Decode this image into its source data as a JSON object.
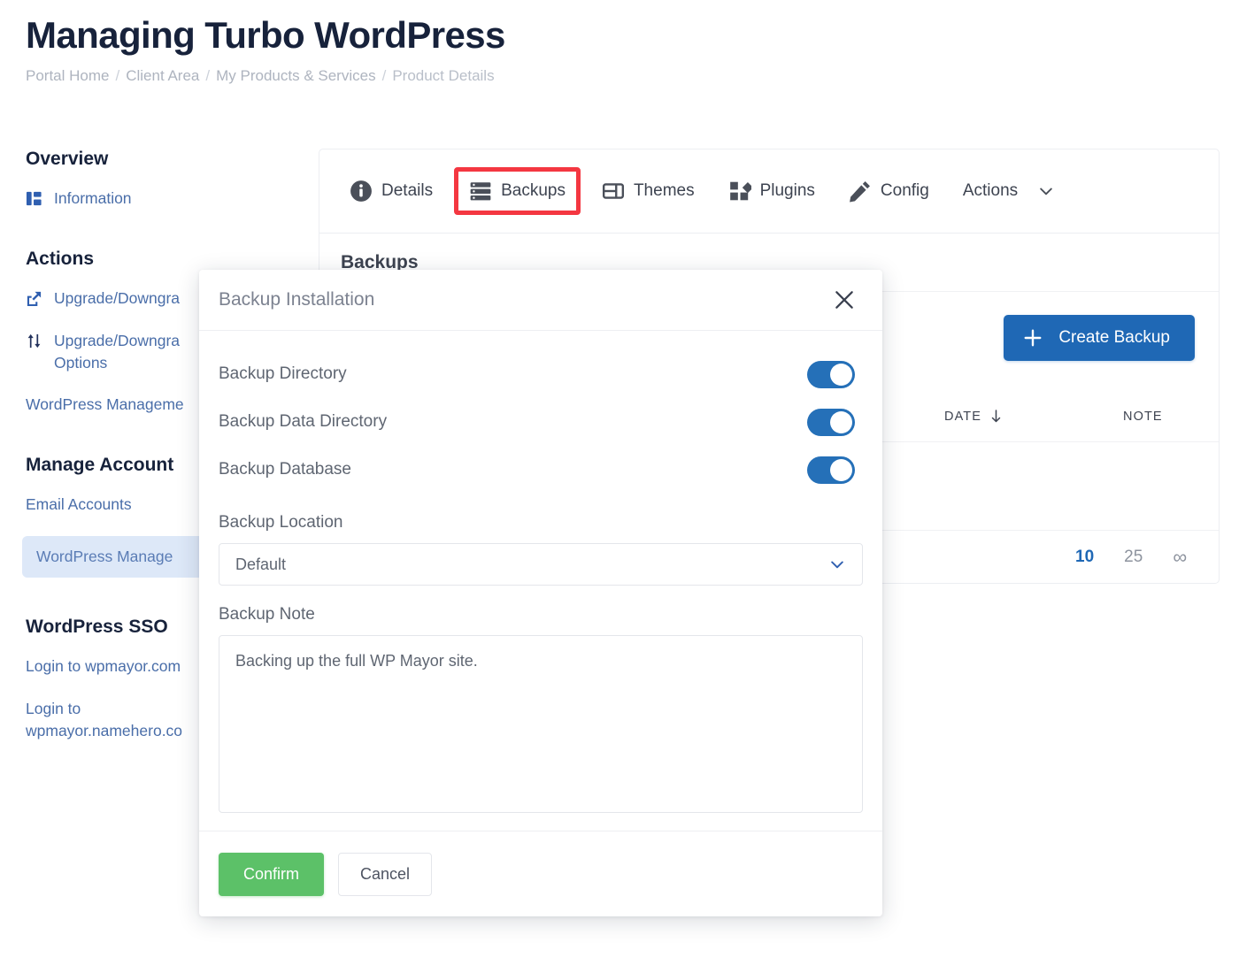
{
  "header": {
    "title": "Managing Turbo WordPress",
    "breadcrumb": [
      "Portal Home",
      "Client Area",
      "My Products & Services",
      "Product Details"
    ],
    "separator": "/"
  },
  "sidebar": {
    "groups": [
      {
        "title": "Overview",
        "items": [
          {
            "label": "Information",
            "icon": "layout-columns-icon",
            "active": false
          }
        ]
      },
      {
        "title": "Actions",
        "items": [
          {
            "label": "Upgrade/Downgra",
            "icon": "external-link-icon",
            "active": false
          },
          {
            "label": "Upgrade/Downgra Options",
            "icon": "arrows-up-down-icon",
            "active": false
          },
          {
            "label": "WordPress Manageme",
            "icon": "none",
            "active": false
          }
        ]
      },
      {
        "title": "Manage Account",
        "items": [
          {
            "label": "Email Accounts",
            "icon": "none",
            "active": false
          },
          {
            "label": "WordPress Manage",
            "icon": "none",
            "active": true
          }
        ]
      },
      {
        "title": "WordPress SSO",
        "items": [
          {
            "label": "Login to wpmayor.com",
            "icon": "none",
            "active": false
          },
          {
            "label": "Login to wpmayor.namehero.co",
            "icon": "none",
            "active": false
          }
        ]
      }
    ]
  },
  "tabs": [
    {
      "label": "Details",
      "icon": "info-circle-icon",
      "highlighted": false
    },
    {
      "label": "Backups",
      "icon": "server-stack-icon",
      "highlighted": true
    },
    {
      "label": "Themes",
      "icon": "layout-panel-icon",
      "highlighted": false
    },
    {
      "label": "Plugins",
      "icon": "plugin-blocks-icon",
      "highlighted": false
    },
    {
      "label": "Config",
      "icon": "pencil-icon",
      "highlighted": false
    },
    {
      "label": "Actions",
      "icon": "chevron-down-icon",
      "highlighted": false
    }
  ],
  "panel": {
    "heading": "Backups",
    "create_button": {
      "label": "Create Backup",
      "icon": "plus-icon"
    },
    "columns": [
      {
        "label": "DATE",
        "sort_icon": "sort-arrow-down-icon"
      },
      {
        "label": "NOTE",
        "sort_icon": "none"
      }
    ],
    "rows": [],
    "pagination": [
      {
        "label": "10",
        "active": true
      },
      {
        "label": "25",
        "active": false
      },
      {
        "label": "∞",
        "active": false
      }
    ]
  },
  "modal": {
    "title": "Backup Installation",
    "close_icon": "close-icon",
    "toggles": [
      {
        "label": "Backup Directory",
        "on": true
      },
      {
        "label": "Backup Data Directory",
        "on": true
      },
      {
        "label": "Backup Database",
        "on": true
      }
    ],
    "location": {
      "label": "Backup Location",
      "value": "Default",
      "chevron_icon": "chevron-down-icon"
    },
    "note": {
      "label": "Backup Note",
      "value": "Backing up the full WP Mayor site.",
      "placeholder": ""
    },
    "confirm_label": "Confirm",
    "cancel_label": "Cancel"
  },
  "colors": {
    "title": "#17223b",
    "breadcrumb": "#aeb4bf",
    "link_blue": "#4a6ea9",
    "primary_blue": "#1f68b5",
    "toggle_blue": "#2570b8",
    "highlight_red": "#f43741",
    "confirm_green": "#5cc168",
    "active_bg": "#dde8f8"
  }
}
